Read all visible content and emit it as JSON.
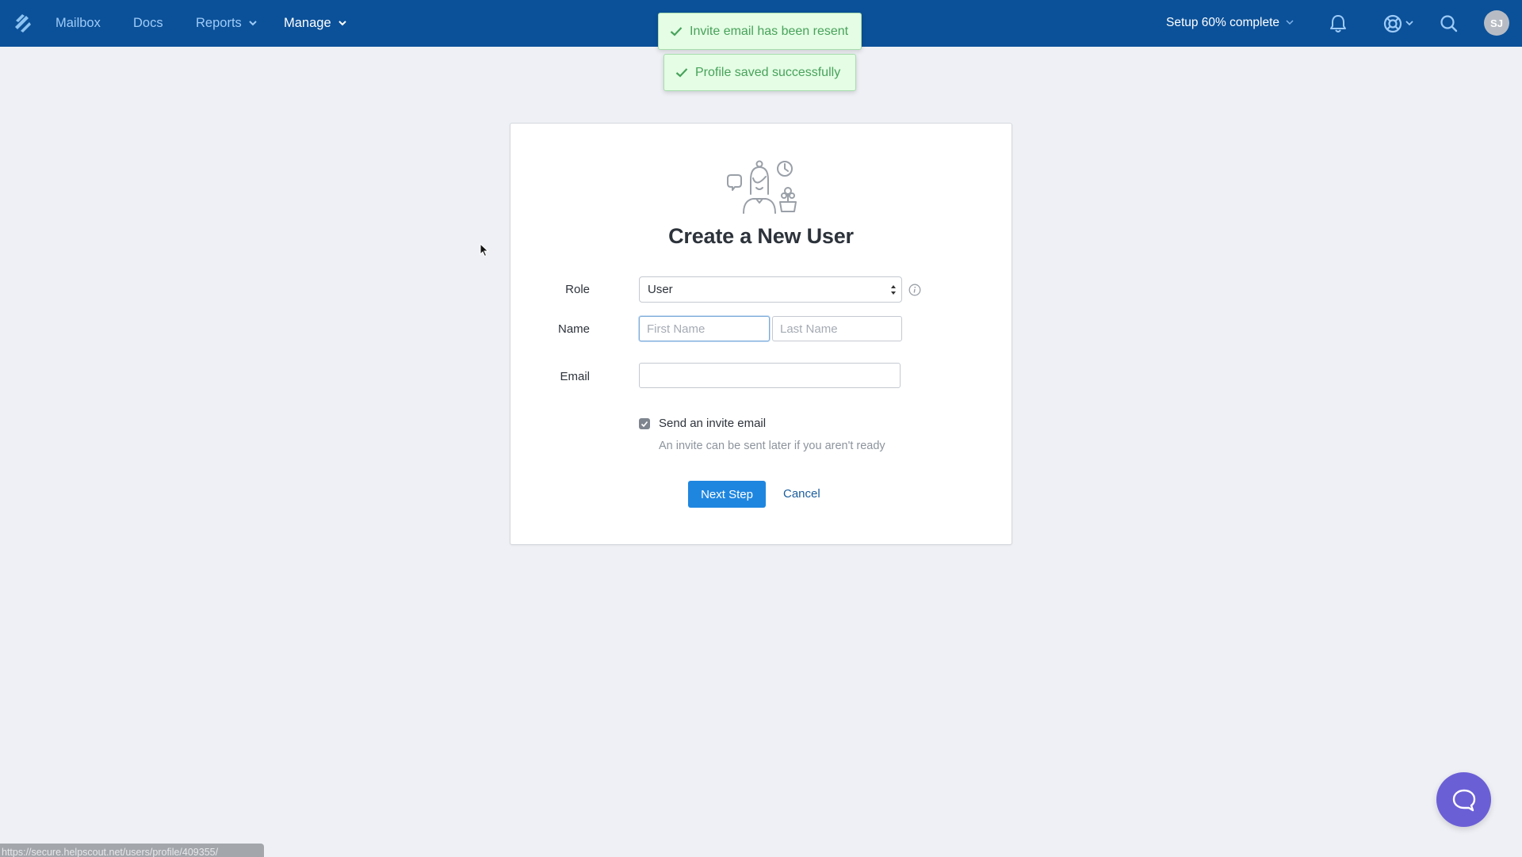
{
  "nav": {
    "items": [
      {
        "label": "Mailbox",
        "has_dropdown": false,
        "active": false
      },
      {
        "label": "Docs",
        "has_dropdown": false,
        "active": false
      },
      {
        "label": "Reports",
        "has_dropdown": true,
        "active": false
      },
      {
        "label": "Manage",
        "has_dropdown": true,
        "active": true
      }
    ],
    "setup_progress_label": "Setup 60% complete",
    "setup_progress_percent": 60,
    "icons": [
      "logo-icon",
      "bell-icon",
      "lifebuoy-icon",
      "search-icon"
    ],
    "avatar_initials": "SJ"
  },
  "toasts": [
    {
      "message": "Invite email has been resent",
      "type": "success"
    },
    {
      "message": "Profile saved successfully",
      "type": "success"
    }
  ],
  "form": {
    "title": "Create a New User",
    "role_label": "Role",
    "role_value": "User",
    "name_label": "Name",
    "first_name_placeholder": "First Name",
    "first_name_value": "",
    "last_name_placeholder": "Last Name",
    "last_name_value": "",
    "email_label": "Email",
    "email_value": "",
    "send_invite_label": "Send an invite email",
    "send_invite_checked": true,
    "send_invite_help": "An invite can be sent later if you aren't ready",
    "next_button": "Next Step",
    "cancel_button": "Cancel"
  },
  "status_bar_url": "https://secure.helpscout.net/users/profile/409355/",
  "colors": {
    "nav_bg": "#0b5199",
    "primary": "#1f86e0",
    "toast_bg": "#e4fde4",
    "toast_text": "#48a25b",
    "beacon": "#6b5fd6",
    "page_bg": "#eef0f5"
  }
}
